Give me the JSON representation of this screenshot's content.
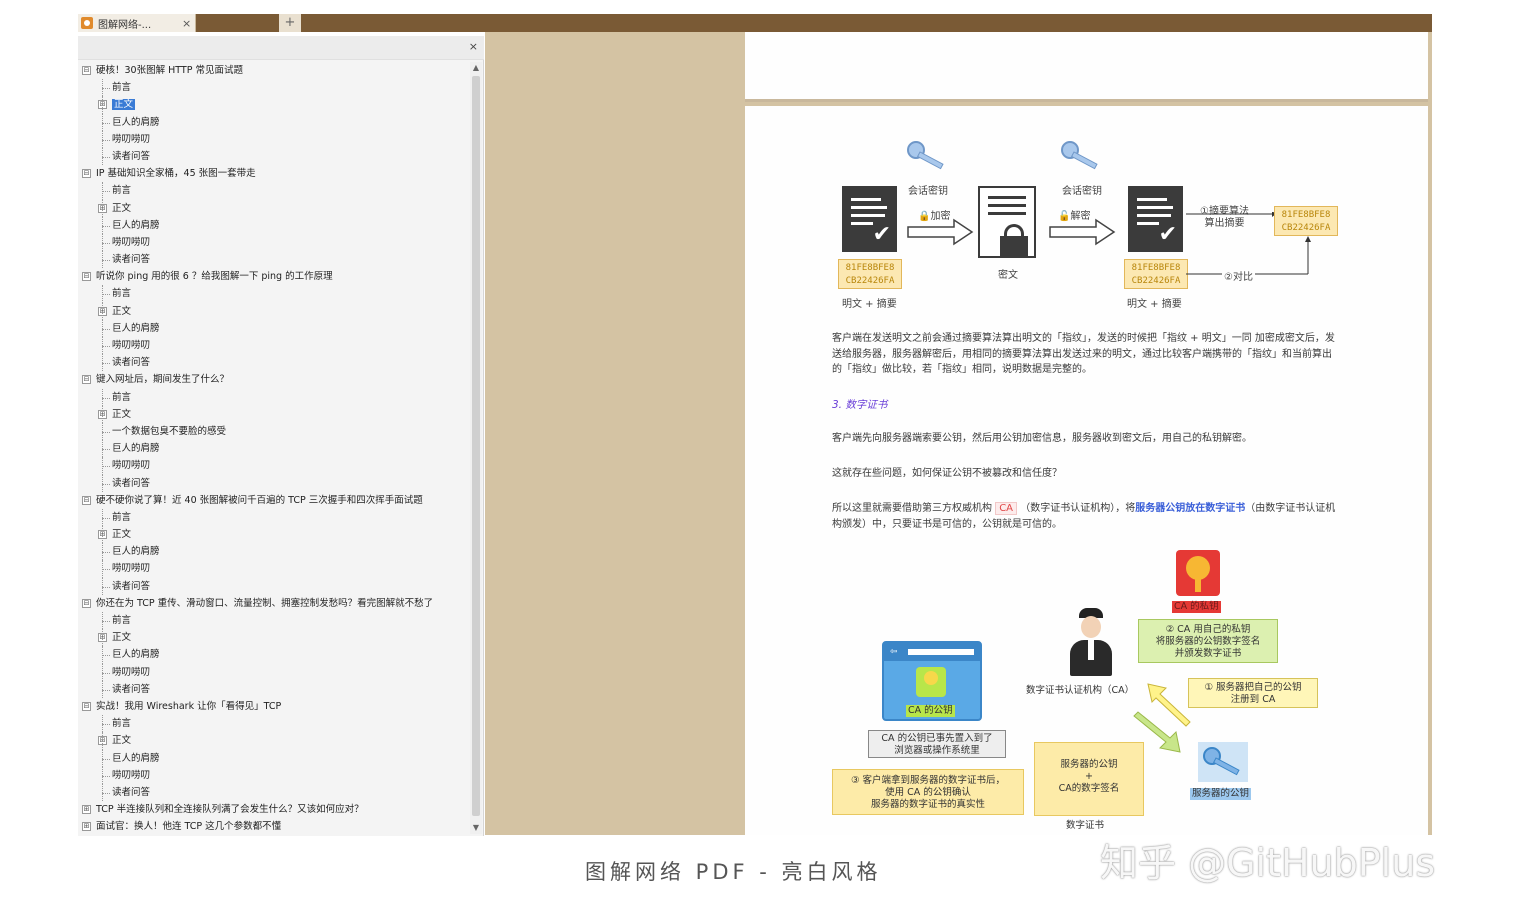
{
  "app": {
    "tab_title": "图解网络-...",
    "tab_close": "×",
    "tab_add": "+"
  },
  "outline": {
    "close": "×",
    "scroll_up": "▲",
    "scroll_down": "▼",
    "items": [
      {
        "level": 0,
        "toggle": "⊟",
        "label": "硬核！30张图解 HTTP 常见面试题"
      },
      {
        "level": 1,
        "label": "前言"
      },
      {
        "level": 1,
        "toggle": "⊞",
        "label": "正文",
        "selected": true
      },
      {
        "level": 1,
        "label": "巨人的肩膀"
      },
      {
        "level": 1,
        "label": "唠叨唠叨"
      },
      {
        "level": 1,
        "label": "读者问答"
      },
      {
        "level": 0,
        "toggle": "⊟",
        "label": "IP 基础知识全家桶，45 张图一套带走"
      },
      {
        "level": 1,
        "label": "前言"
      },
      {
        "level": 1,
        "toggle": "⊞",
        "label": "正文"
      },
      {
        "level": 1,
        "label": "巨人的肩膀"
      },
      {
        "level": 1,
        "label": "唠叨唠叨"
      },
      {
        "level": 1,
        "label": "读者问答"
      },
      {
        "level": 0,
        "toggle": "⊟",
        "label": "听说你 ping 用的很 6 ？给我图解一下 ping 的工作原理"
      },
      {
        "level": 1,
        "label": "前言"
      },
      {
        "level": 1,
        "toggle": "⊞",
        "label": "正文"
      },
      {
        "level": 1,
        "label": "巨人的肩膀"
      },
      {
        "level": 1,
        "label": "唠叨唠叨"
      },
      {
        "level": 1,
        "label": "读者问答"
      },
      {
        "level": 0,
        "toggle": "⊟",
        "label": "键入网址后，期间发生了什么？"
      },
      {
        "level": 1,
        "label": "前言"
      },
      {
        "level": 1,
        "toggle": "⊞",
        "label": "正文"
      },
      {
        "level": 1,
        "label": "一个数据包臭不要脸的感受"
      },
      {
        "level": 1,
        "label": "巨人的肩膀"
      },
      {
        "level": 1,
        "label": "唠叨唠叨"
      },
      {
        "level": 1,
        "label": "读者问答"
      },
      {
        "level": 0,
        "toggle": "⊟",
        "label": "硬不硬你说了算！近 40 张图解被问千百遍的 TCP 三次握手和四次挥手面试题"
      },
      {
        "level": 1,
        "label": "前言"
      },
      {
        "level": 1,
        "toggle": "⊞",
        "label": "正文"
      },
      {
        "level": 1,
        "label": "巨人的肩膀"
      },
      {
        "level": 1,
        "label": "唠叨唠叨"
      },
      {
        "level": 1,
        "label": "读者问答"
      },
      {
        "level": 0,
        "toggle": "⊟",
        "label": "你还在为 TCP 重传、滑动窗口、流量控制、拥塞控制发愁吗？看完图解就不愁了"
      },
      {
        "level": 1,
        "label": "前言"
      },
      {
        "level": 1,
        "toggle": "⊞",
        "label": "正文"
      },
      {
        "level": 1,
        "label": "巨人的肩膀"
      },
      {
        "level": 1,
        "label": "唠叨唠叨"
      },
      {
        "level": 1,
        "label": "读者问答"
      },
      {
        "level": 0,
        "toggle": "⊟",
        "label": "实战！我用 Wireshark 让你「看得见」TCP"
      },
      {
        "level": 1,
        "label": "前言"
      },
      {
        "level": 1,
        "toggle": "⊞",
        "label": "正文"
      },
      {
        "level": 1,
        "label": "巨人的肩膀"
      },
      {
        "level": 1,
        "label": "唠叨唠叨"
      },
      {
        "level": 1,
        "label": "读者问答"
      },
      {
        "level": 0,
        "toggle": "⊞",
        "label": "TCP 半连接队列和全连接队列满了会发生什么？又该如何应对？"
      },
      {
        "level": 0,
        "toggle": "⊞",
        "label": "面试官：换人！他连 TCP 这几个参数都不懂"
      }
    ]
  },
  "diagram1": {
    "session_key_left": "会话密钥",
    "encrypt": "加密",
    "session_key_right": "会话密钥",
    "decrypt": "解密",
    "cipher_label": "密文",
    "hash_left": [
      "81FE8BFE8",
      "CB22426FA"
    ],
    "hash_mid": [
      "81FE8BFE8",
      "CB22426FA"
    ],
    "hash_right": [
      "81FE8BFE8",
      "CB22426FA"
    ],
    "plain_digest_left": "明文 + 摘要",
    "plain_digest_right": "明文 + 摘要",
    "step1_line1": "①摘要算法",
    "step1_line2": "算出摘要",
    "step2": "②对比"
  },
  "body": {
    "para1": "客户端在发送明文之前会通过摘要算法算出明文的「指纹」，发送的时候把「指纹 + 明文」一同 加密成密文后，发送给服务器，服务器解密后，用相同的摘要算法算出发送过来的明文，通过比较客户端携带的「指纹」和当前算出的「指纹」做比较，若「指纹」相同，说明数据是完整的。",
    "heading": "3. 数字证书",
    "para2": "客户端先向服务器端索要公钥，然后用公钥加密信息，服务器收到密文后，用自己的私钥解密。",
    "para3": "这就存在些问题，如何保证公钥不被篡改和信任度？",
    "para4_a": "所以这里就需要借助第三方权威机构 ",
    "para4_ca": "CA",
    "para4_b": " （数字证书认证机构），将",
    "para4_link": "服务器公钥放在数字证书",
    "para4_c": "（由数字证书认证机构颁发）中，只要证书是可信的，公钥就是可信的。"
  },
  "diagram2": {
    "ca_private_key": "CA 的私钥",
    "step2_l1": "② CA 用自己的私钥",
    "step2_l2": "将服务器的公钥数字签名",
    "step2_l3": "并颁发数字证书",
    "ca_org": "数字证书认证机构（CA）",
    "step1_l1": "① 服务器把自己的公钥",
    "step1_l2": "注册到 CA",
    "ca_public_key": "CA 的公钥",
    "preinstalled_l1": "CA 的公钥已事先置入到了",
    "preinstalled_l2": "浏览器或操作系统里",
    "server_pub_l1": "服务器的公钥",
    "server_pub_l2": "+",
    "server_pub_l3": "CA的数字签名",
    "cert_label": "数字证书",
    "server_public_key": "服务器的公钥",
    "step3_l1": "③ 客户端拿到服务器的数字证书后，",
    "step3_l2": "使用 CA 的公钥确认",
    "step3_l3": "服务器的数字证书的真实性"
  },
  "caption": "图解网络 PDF - 亮白风格",
  "watermark": "知乎 @GitHubPlus",
  "colors": {
    "tabbar": "#7a5a35",
    "backdrop": "#d4c3a3",
    "selection": "#3a7bd5",
    "heading": "#6a3fd8",
    "hash_text": "#b8860b"
  }
}
